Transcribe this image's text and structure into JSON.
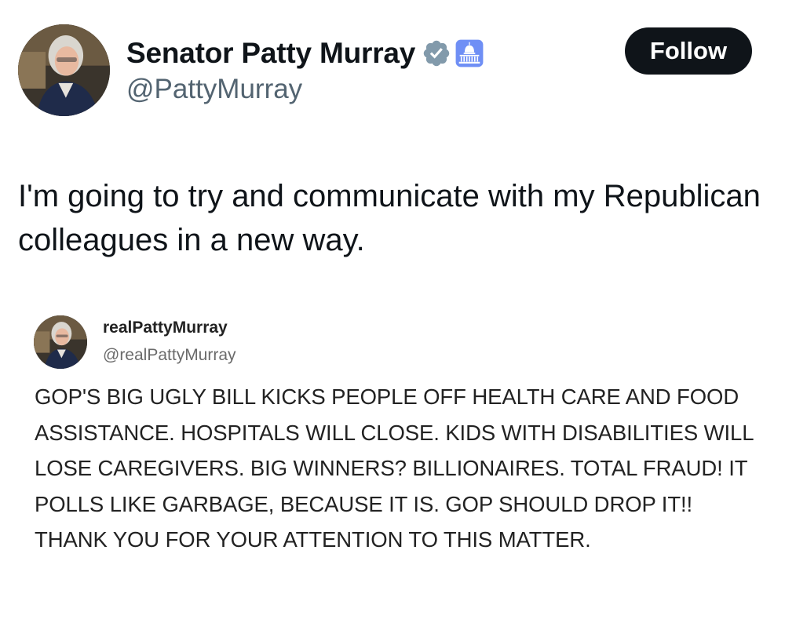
{
  "author": {
    "display_name": "Senator Patty Murray",
    "handle": "@PattyMurray",
    "verified_icon": "verified-badge-icon",
    "government_icon": "capitol-building-icon",
    "colors": {
      "verified_badge": "#829aab",
      "government_badge": "#6f8ff5"
    }
  },
  "follow_button": {
    "label": "Follow"
  },
  "tweet": {
    "text": "I'm going to try and communicate with my Republican colleagues in a new way."
  },
  "embedded_post": {
    "display_name": "realPattyMurray",
    "handle": "@realPattyMurray",
    "text": "GOP'S BIG UGLY BILL KICKS PEOPLE OFF HEALTH CARE AND FOOD ASSISTANCE. HOSPITALS WILL CLOSE. KIDS WITH DISABILITIES WILL LOSE CAREGIVERS. BIG WINNERS? BILLIONAIRES. TOTAL FRAUD! IT POLLS LIKE GARBAGE, BECAUSE IT IS. GOP SHOULD DROP IT!! THANK YOU FOR YOUR ATTENTION TO THIS MATTER."
  }
}
